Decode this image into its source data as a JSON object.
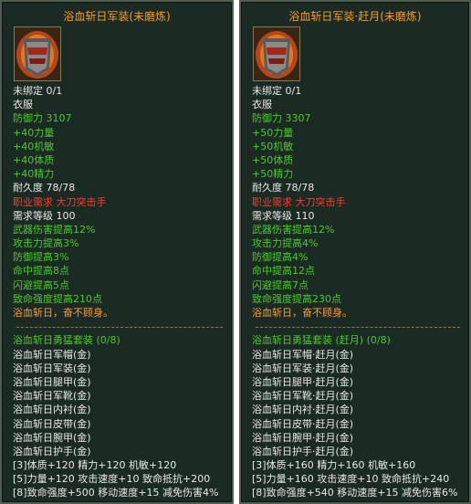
{
  "left": {
    "title": "浴血斩日军装(未磨炼)",
    "binding": "未绑定 0/1",
    "slot": "衣服",
    "defense": "防御力 3107",
    "stats": [
      "+40力量",
      "+40机敏",
      "+40体质",
      "+40精力"
    ],
    "durability": "耐久度 78/78",
    "job_req": "职业需求 大刀突击手",
    "level_req": "需求等级 100",
    "bonuses": [
      "武器伤害提高12%",
      "攻击力提高3%",
      "防御提高3%",
      "命中提高8点",
      "闪避提高5点",
      "致命强度提高210点"
    ],
    "flavor": "浴血斩日，奋不顾身。",
    "set_name": "浴血斩日勇猛套装 (0/8)",
    "set_items": [
      "浴血斩日军帽(金)",
      "浴血斩日军装(金)",
      "浴血斩日腿甲(金)",
      "浴血斩日军靴(金)",
      "浴血斩日内衬(金)",
      "浴血斩日皮带(金)",
      "浴血斩日腕甲(金)",
      "浴血斩日护手(金)"
    ],
    "set_bonuses": [
      "[3]体质+120 精力+120 机敏+120",
      "[5]力量+120 攻击速度+10 致命抵抗+200",
      "[8]致命强度+500 移动速度+15 减免伤害4%"
    ]
  },
  "right": {
    "title": "浴血斩日军装·赶月(未磨炼)",
    "binding": "未绑定 0/1",
    "slot": "衣服",
    "defense": "防御力 3307",
    "stats": [
      "+50力量",
      "+50机敏",
      "+50体质",
      "+50精力"
    ],
    "durability": "耐久度 78/78",
    "job_req": "职业需求 大刀突击手",
    "level_req": "需求等级 110",
    "bonuses": [
      "武器伤害提高12%",
      "攻击力提高4%",
      "防御提高4%",
      "命中提高12点",
      "闪避提高7点",
      "致命强度提高230点"
    ],
    "flavor": "浴血斩日，奋不顾身。",
    "set_name": "浴血斩日勇猛套装 (赶月) (0/8)",
    "set_items": [
      "浴血斩日军帽·赶月(金)",
      "浴血斩日军装·赶月(金)",
      "浴血斩日腿甲·赶月(金)",
      "浴血斩日军靴·赶月(金)",
      "浴血斩日内衬·赶月(金)",
      "浴血斩日皮带·赶月(金)",
      "浴血斩日腕甲·赶月(金)",
      "浴血斩日护手·赶月(金)"
    ],
    "set_bonuses": [
      "[3]体质+160 精力+160 机敏+160",
      "[5]力量+160 攻击速度+10 致命抵抗+240",
      "[8]致命强度+540 移动速度+15 减免伤害6%"
    ]
  }
}
